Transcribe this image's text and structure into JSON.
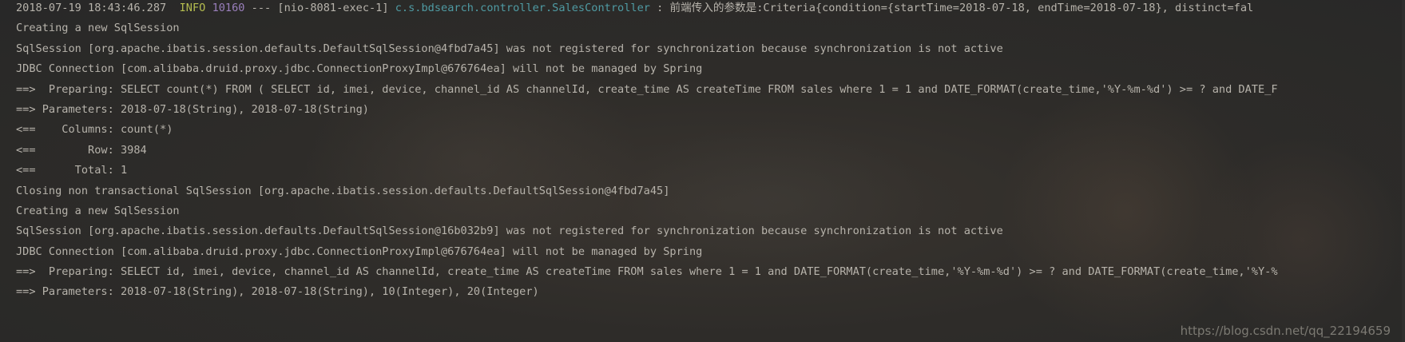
{
  "console": {
    "lines": [
      {
        "timestamp": "2018-07-19 18:43:46.287",
        "level": "INFO",
        "pid": "10160",
        "sep": "---",
        "thread": "[nio-8081-exec-1]",
        "logger": "c.s.bdsearch.controller.SalesController",
        "message": " : 前端传入的参数是:Criteria{condition={startTime=2018-07-18, endTime=2018-07-18}, distinct=fal"
      },
      {
        "text": "Creating a new SqlSession"
      },
      {
        "text": "SqlSession [org.apache.ibatis.session.defaults.DefaultSqlSession@4fbd7a45] was not registered for synchronization because synchronization is not active"
      },
      {
        "text": "JDBC Connection [com.alibaba.druid.proxy.jdbc.ConnectionProxyImpl@676764ea] will not be managed by Spring"
      },
      {
        "text": "==>  Preparing: SELECT count(*) FROM ( SELECT id, imei, device, channel_id AS channelId, create_time AS createTime FROM sales where 1 = 1 and DATE_FORMAT(create_time,'%Y-%m-%d') >= ? and DATE_F"
      },
      {
        "text": "==> Parameters: 2018-07-18(String), 2018-07-18(String)"
      },
      {
        "text": "<==    Columns: count(*)"
      },
      {
        "text": "<==        Row: 3984"
      },
      {
        "text": "<==      Total: 1"
      },
      {
        "text": "Closing non transactional SqlSession [org.apache.ibatis.session.defaults.DefaultSqlSession@4fbd7a45]"
      },
      {
        "text": "Creating a new SqlSession"
      },
      {
        "text": "SqlSession [org.apache.ibatis.session.defaults.DefaultSqlSession@16b032b9] was not registered for synchronization because synchronization is not active"
      },
      {
        "text": "JDBC Connection [com.alibaba.druid.proxy.jdbc.ConnectionProxyImpl@676764ea] will not be managed by Spring"
      },
      {
        "text": "==>  Preparing: SELECT id, imei, device, channel_id AS channelId, create_time AS createTime FROM sales where 1 = 1 and DATE_FORMAT(create_time,'%Y-%m-%d') >= ? and DATE_FORMAT(create_time,'%Y-%"
      },
      {
        "text": "==> Parameters: 2018-07-18(String), 2018-07-18(String), 10(Integer), 20(Integer)"
      }
    ]
  },
  "watermark": "https://blog.csdn.net/qq_22194659",
  "colors": {
    "text": "#b7b3ab",
    "info_level": "#b5bd4f",
    "pid": "#9a7fbc",
    "logger": "#4f9ba3",
    "background": "#2b2b2b"
  }
}
